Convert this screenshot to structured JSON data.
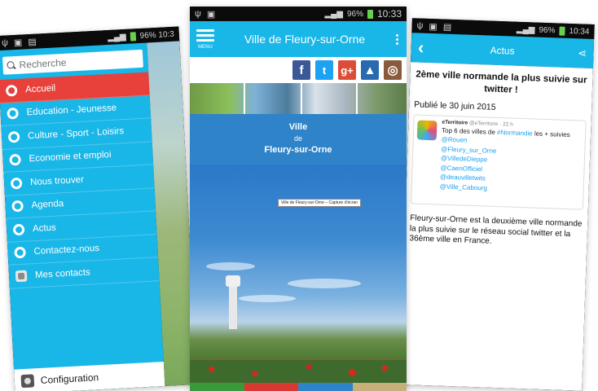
{
  "left_phone": {
    "status": {
      "right": "96% 10:3"
    },
    "search": {
      "placeholder": "Recherche"
    },
    "menu_items": [
      {
        "label": "Accueil",
        "active": true
      },
      {
        "label": "Education - Jeunesse"
      },
      {
        "label": "Culture - Sport - Loisirs"
      },
      {
        "label": "Economie et emploi"
      },
      {
        "label": "Nous trouver"
      },
      {
        "label": "Agenda"
      },
      {
        "label": "Actus"
      },
      {
        "label": "Contactez-nous"
      },
      {
        "label": "Mes contacts"
      }
    ],
    "config_label": "Configuration",
    "colors": {
      "menu_bg": "#19b6e8",
      "active_bg": "#e8403b"
    }
  },
  "middle_phone": {
    "status": {
      "battery": "96%",
      "time": "10:33"
    },
    "app_title": "Ville de Fleury-sur-Orne",
    "menu_label": "MENU",
    "social_icons": [
      "facebook-icon",
      "twitter-icon",
      "google-plus-icon",
      "city-logo-icon",
      "instagram-icon"
    ],
    "social_glyphs": {
      "facebook": "f",
      "twitter": "t",
      "googleplus": "g+",
      "city": "▲",
      "instagram": "◎"
    },
    "city": {
      "line1": "Ville",
      "line2": "de",
      "line3": "Fleury-sur-Orne"
    },
    "caption_tag": "Ville de Fleury-sur-Orne – Capture d'écran",
    "tab_colors": [
      "#3a9a3a",
      "#d83a32",
      "#2f83c8",
      "#c8b07a"
    ],
    "colors": {
      "appbar": "#19b6e8",
      "city_block": "#2f83c8"
    }
  },
  "right_phone": {
    "status": {
      "battery": "96%",
      "time": "10:34"
    },
    "app_title": "Actus",
    "news_title": "2ème ville normande la plus suivie sur twitter !",
    "published": "Publié le 30 juin 2015",
    "tweet": {
      "account": "eTerritoire",
      "meta": "@eTerritoire · 22 h",
      "text_before": "Top 6 des villes de ",
      "hashtag": "#Normandie",
      "text_after": " les + suivies",
      "handles": [
        "@Rouen",
        "@Fleury_sur_Orne",
        "@VilledeDieppe",
        "@CaenOfficiel",
        "@deauvilletwits",
        "@Ville_Cabourg"
      ]
    },
    "body": "Fleury-sur-Orne est la deuxième ville normande la plus suivie sur le réseau social twitter et la 36ème ville en France.",
    "colors": {
      "appbar": "#19b6e8"
    }
  }
}
